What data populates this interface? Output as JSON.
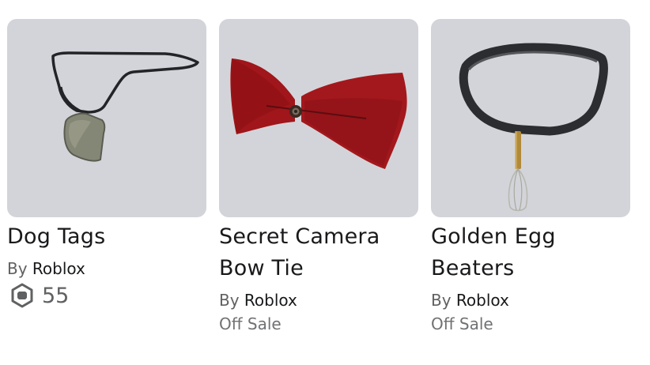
{
  "items": [
    {
      "name": "Dog Tags",
      "creator_prefix": "By",
      "creator": "Roblox",
      "price": "55",
      "price_icon": "robux-icon"
    },
    {
      "name_line1": "Secret Camera",
      "name_line2": "Bow Tie",
      "creator_prefix": "By",
      "creator": "Roblox",
      "status": "Off Sale"
    },
    {
      "name_line1": "Golden Egg",
      "name_line2": "Beaters",
      "creator_prefix": "By",
      "creator": "Roblox",
      "status": "Off Sale"
    }
  ],
  "colors": {
    "thumbnail_bg": "#d3d4d9",
    "title_text": "#18191b",
    "muted_text": "#606162"
  }
}
